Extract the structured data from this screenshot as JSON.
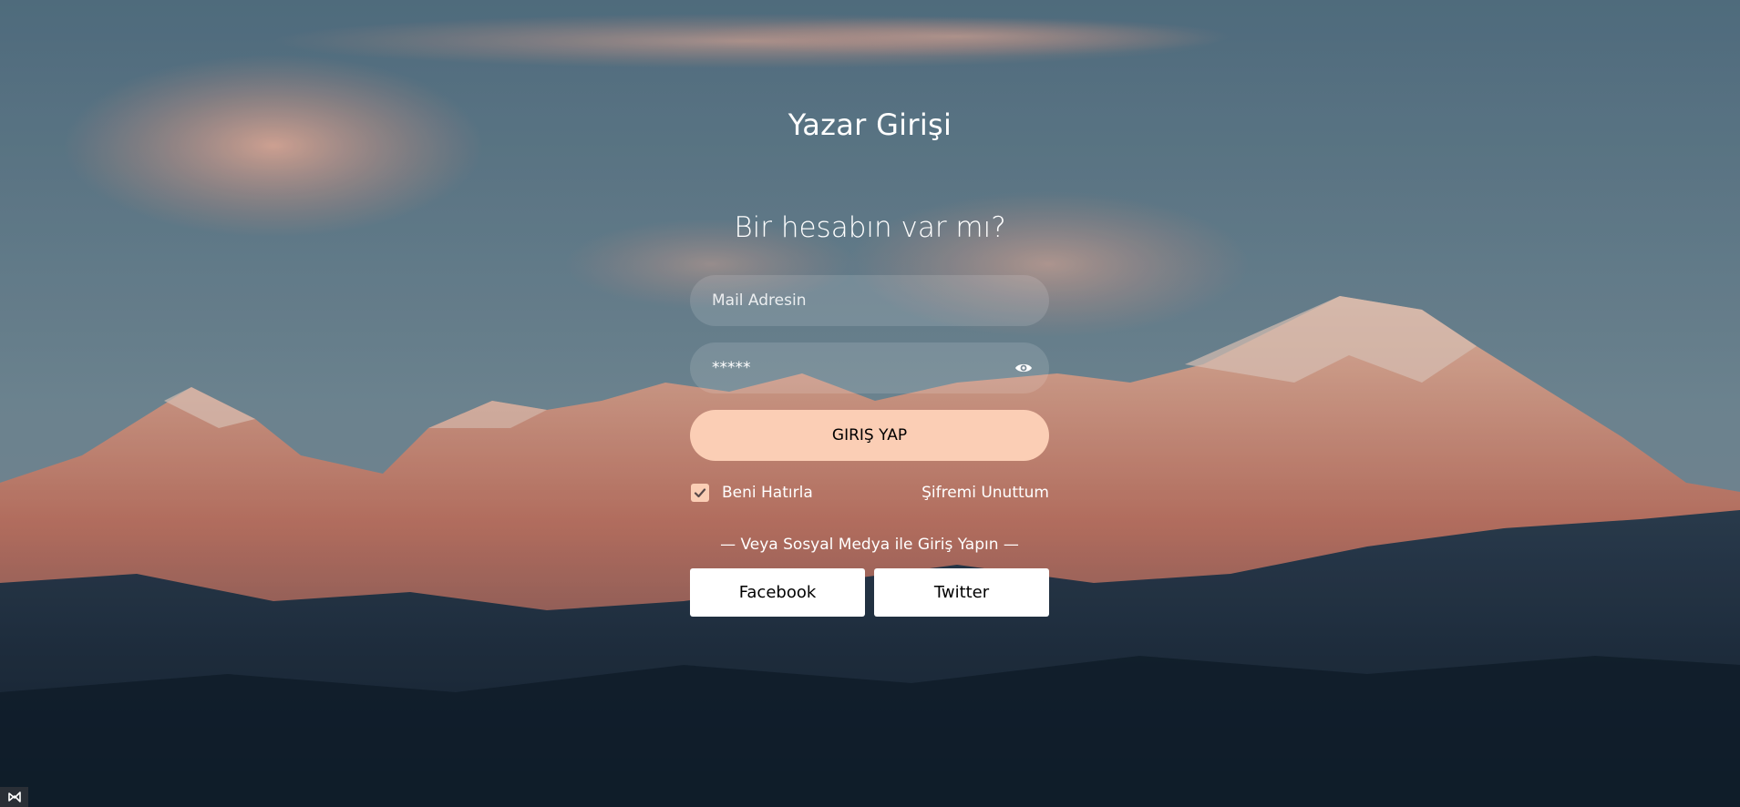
{
  "page": {
    "title": "Yazar Girişi",
    "subtitle": "Bir hesabın var mı?"
  },
  "form": {
    "email_placeholder": "Mail Adresin",
    "password_value": "*****",
    "login_label": "GIRIŞ YAP",
    "remember_label": "Beni Hatırla",
    "remember_checked": true,
    "forgot_label": "Şifremi Unuttum"
  },
  "social": {
    "divider_text": "— Veya Sosyal Medya ile Giriş Yapın —",
    "facebook_label": "Facebook",
    "twitter_label": "Twitter"
  },
  "colors": {
    "accent": "#fbceb5",
    "text": "#ffffff"
  },
  "icons": {
    "password_toggle": "eye-icon",
    "remember_check": "check-icon",
    "corner": "vscode-icon"
  }
}
